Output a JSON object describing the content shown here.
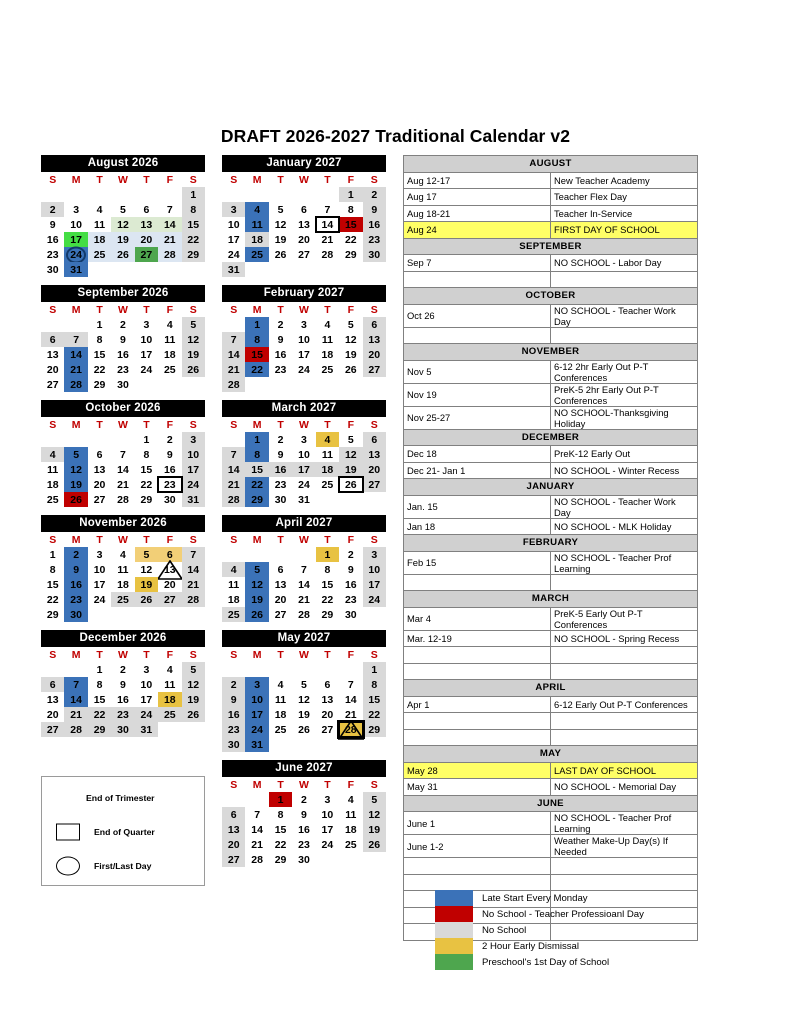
{
  "title": "DRAFT 2026-2027 Traditional Calendar v2",
  "weekday_headers": [
    "S",
    "M",
    "T",
    "W",
    "T",
    "F",
    "S"
  ],
  "months_left": [
    {
      "name": "August  2026",
      "lead": 6,
      "days": 31,
      "styles": {
        "1": "gray",
        "2": "gray",
        "8": "gray",
        "9": "",
        "15": "gray",
        "22": "gray",
        "29": "gray",
        "12": "lgreen",
        "13": "lgreen",
        "14": "lgreen",
        "17": "bgreen",
        "18": "lblue",
        "19": "lblue",
        "20": "lblue",
        "21": "lblue",
        "24": "blue",
        "25": "lblue",
        "26": "lblue",
        "27": "green",
        "28": "lblue",
        "31": "blue"
      },
      "markers": {
        "24": "circle"
      }
    },
    {
      "name": "September  2026",
      "lead": 2,
      "days": 30,
      "styles": {
        "5": "gray",
        "6": "gray",
        "7": "gray",
        "12": "gray",
        "19": "gray",
        "26": "gray",
        "14": "blue",
        "21": "blue",
        "28": "blue"
      },
      "markers": {}
    },
    {
      "name": "October  2026",
      "lead": 4,
      "days": 31,
      "styles": {
        "3": "gray",
        "4": "gray",
        "10": "gray",
        "17": "gray",
        "24": "gray",
        "31": "gray",
        "5": "blue",
        "12": "blue",
        "19": "blue",
        "26": "red"
      },
      "markers": {
        "23": "box"
      }
    },
    {
      "name": "November  2026",
      "lead": 0,
      "days": 30,
      "styles": {
        "1": "",
        "7": "gray",
        "14": "gray",
        "21": "gray",
        "28": "gray",
        "2": "blue",
        "9": "blue",
        "16": "blue",
        "23": "blue",
        "30": "blue",
        "5": "lgold",
        "6": "lgold",
        "19": "gold",
        "25": "gray",
        "26": "gray",
        "27": "gray"
      },
      "markers": {
        "13": "triangle"
      }
    },
    {
      "name": "December  2026",
      "lead": 2,
      "days": 31,
      "styles": {
        "5": "gray",
        "6": "gray",
        "12": "gray",
        "19": "gray",
        "26": "gray",
        "7": "blue",
        "14": "blue",
        "18": "gold",
        "21": "gray",
        "22": "gray",
        "23": "gray",
        "24": "gray",
        "25": "gray",
        "27": "gray",
        "28": "gray",
        "29": "gray",
        "30": "gray",
        "31": "gray"
      },
      "markers": {}
    }
  ],
  "months_mid": [
    {
      "name": "January  2027",
      "lead": 5,
      "days": 31,
      "styles": {
        "1": "gray",
        "2": "gray",
        "3": "gray",
        "9": "gray",
        "16": "gray",
        "23": "gray",
        "30": "gray",
        "31": "gray",
        "4": "blue",
        "11": "blue",
        "25": "blue",
        "15": "red",
        "18": "gray"
      },
      "markers": {
        "14": "box"
      }
    },
    {
      "name": "February  2027",
      "lead": 1,
      "days": 28,
      "styles": {
        "6": "gray",
        "7": "gray",
        "13": "gray",
        "14": "gray",
        "20": "gray",
        "21": "gray",
        "27": "gray",
        "28": "gray",
        "1": "blue",
        "8": "blue",
        "22": "blue",
        "15": "red"
      },
      "markers": {}
    },
    {
      "name": "March  2027",
      "lead": 1,
      "days": 31,
      "styles": {
        "6": "gray",
        "7": "gray",
        "13": "gray",
        "14": "gray",
        "20": "gray",
        "21": "gray",
        "27": "gray",
        "28": "gray",
        "1": "blue",
        "8": "blue",
        "22": "blue",
        "29": "blue",
        "4": "gold",
        "12": "gray",
        "15": "gray",
        "16": "gray",
        "17": "gray",
        "18": "gray",
        "19": "gray"
      },
      "markers": {
        "26": "box"
      }
    },
    {
      "name": "April  2027",
      "lead": 4,
      "days": 30,
      "styles": {
        "3": "gray",
        "4": "gray",
        "10": "gray",
        "17": "gray",
        "24": "gray",
        "25": "gray",
        "5": "blue",
        "12": "blue",
        "19": "blue",
        "26": "blue",
        "1": "gold"
      },
      "markers": {}
    },
    {
      "name": "May  2027",
      "lead": 6,
      "days": 31,
      "styles": {
        "1": "gray",
        "2": "gray",
        "8": "gray",
        "9": "gray",
        "15": "gray",
        "16": "gray",
        "22": "gray",
        "23": "gray",
        "29": "gray",
        "30": "gray",
        "3": "blue",
        "10": "blue",
        "17": "blue",
        "24": "blue",
        "31": "blue",
        "28": "gold"
      },
      "markers": {
        "28": "box-triangle"
      }
    },
    {
      "name": "June 2027",
      "lead": 2,
      "days": 30,
      "styles": {
        "1": "red",
        "5": "gray",
        "6": "gray",
        "12": "gray",
        "13": "gray",
        "19": "gray",
        "20": "gray",
        "26": "gray",
        "27": "gray"
      },
      "markers": {}
    }
  ],
  "shapes_legend": [
    {
      "shape": "none",
      "label": "End of Trimester"
    },
    {
      "shape": "square",
      "label": "End of Quarter"
    },
    {
      "shape": "circle",
      "label": "First/Last Day"
    }
  ],
  "events": [
    {
      "type": "head",
      "month": "AUGUST"
    },
    {
      "type": "row",
      "date": "Aug 12-17",
      "desc": "New Teacher Academy"
    },
    {
      "type": "row",
      "date": "Aug 17",
      "desc": "Teacher Flex Day"
    },
    {
      "type": "row",
      "date": "Aug 18-21",
      "desc": "Teacher In-Service"
    },
    {
      "type": "row",
      "date": "Aug 24",
      "desc": "FIRST DAY OF SCHOOL",
      "highlight": true
    },
    {
      "type": "head",
      "month": "SEPTEMBER"
    },
    {
      "type": "row",
      "date": "Sep 7",
      "desc": "NO SCHOOL - Labor Day"
    },
    {
      "type": "row",
      "date": "",
      "desc": ""
    },
    {
      "type": "head",
      "month": "OCTOBER"
    },
    {
      "type": "row",
      "date": "Oct 26",
      "desc": "NO SCHOOL - Teacher Work Day"
    },
    {
      "type": "row",
      "date": "",
      "desc": ""
    },
    {
      "type": "head",
      "month": "NOVEMBER"
    },
    {
      "type": "row",
      "date": "Nov 5",
      "desc": "6-12 2hr Early Out P-T Conferences"
    },
    {
      "type": "row",
      "date": "Nov 19",
      "desc": "PreK-5 2hr Early Out P-T Conferences"
    },
    {
      "type": "row",
      "date": "Nov 25-27",
      "desc": "NO SCHOOL-Thanksgiving Holiday"
    },
    {
      "type": "head",
      "month": "DECEMBER"
    },
    {
      "type": "row",
      "date": "Dec 18",
      "desc": "PreK-12 Early Out"
    },
    {
      "type": "row",
      "date": "Dec 21- Jan 1",
      "desc": "NO SCHOOL - Winter Recess"
    },
    {
      "type": "head",
      "month": "JANUARY"
    },
    {
      "type": "row",
      "date": "Jan. 15",
      "desc": "NO SCHOOL - Teacher Work Day"
    },
    {
      "type": "row",
      "date": "Jan 18",
      "desc": "NO SCHOOL - MLK Holiday"
    },
    {
      "type": "head",
      "month": "FEBRUARY"
    },
    {
      "type": "row",
      "date": "Feb 15",
      "desc": "NO SCHOOL - Teacher Prof Learning"
    },
    {
      "type": "row",
      "date": "",
      "desc": ""
    },
    {
      "type": "head",
      "month": "MARCH"
    },
    {
      "type": "row",
      "date": "Mar 4",
      "desc": "PreK-5 Early Out P-T Conferences"
    },
    {
      "type": "row",
      "date": "Mar. 12-19",
      "desc": "NO SCHOOL - Spring Recess"
    },
    {
      "type": "row",
      "date": "",
      "desc": ""
    },
    {
      "type": "row",
      "date": "",
      "desc": ""
    },
    {
      "type": "head",
      "month": "APRIL"
    },
    {
      "type": "row",
      "date": "Apr 1",
      "desc": "6-12 Early Out P-T Conferences"
    },
    {
      "type": "row",
      "date": "",
      "desc": ""
    },
    {
      "type": "row",
      "date": "",
      "desc": ""
    },
    {
      "type": "head",
      "month": "MAY"
    },
    {
      "type": "row",
      "date": "May 28",
      "desc": "LAST DAY OF SCHOOL",
      "highlight": true
    },
    {
      "type": "row",
      "date": "May 31",
      "desc": "NO SCHOOL - Memorial Day"
    },
    {
      "type": "head",
      "month": "JUNE"
    },
    {
      "type": "row",
      "date": "June 1",
      "desc": "NO SCHOOL - Teacher Prof Learning"
    },
    {
      "type": "row",
      "date": "June 1-2",
      "desc": "Weather Make-Up Day(s) If Needed"
    },
    {
      "type": "row",
      "date": "",
      "desc": ""
    },
    {
      "type": "row",
      "date": "",
      "desc": ""
    },
    {
      "type": "row",
      "date": "",
      "desc": ""
    },
    {
      "type": "row",
      "date": "",
      "desc": ""
    },
    {
      "type": "row",
      "date": "",
      "desc": ""
    }
  ],
  "color_legend": [
    {
      "color": "#3b72b8",
      "label": "Late Start Every Monday"
    },
    {
      "color": "#c00000",
      "label": "No School - Teacher Professioanl Day"
    },
    {
      "color": "#d9d9d9",
      "label": "No School"
    },
    {
      "color": "#e8c242",
      "label": "2 Hour Early Dismissal"
    },
    {
      "color": "#4ea64e",
      "label": "Preschool's 1st Day of School"
    }
  ]
}
